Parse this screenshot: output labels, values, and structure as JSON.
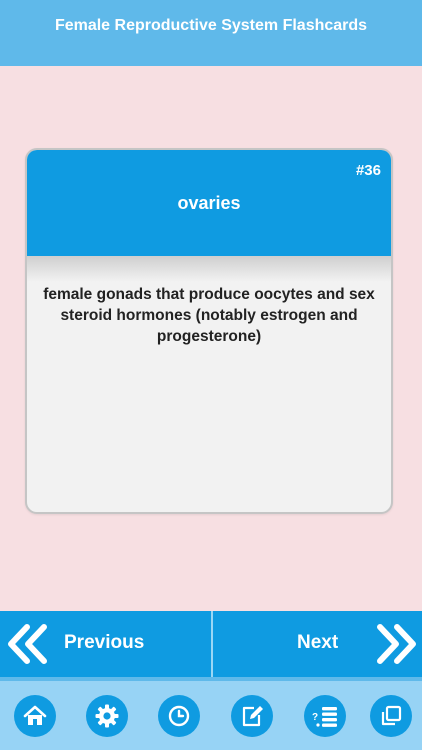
{
  "header": {
    "title": "Female Reproductive System Flashcards"
  },
  "card": {
    "number": "#36",
    "term": "ovaries",
    "definition": "female gonads that produce oocytes and sex steroid hormones (notably estrogen and progesterone)"
  },
  "navigation": {
    "previous_label": "Previous",
    "next_label": "Next"
  },
  "toolbar": {
    "icons": [
      "home-icon",
      "settings-icon",
      "history-icon",
      "edit-icon",
      "quiz-list-icon",
      "copy-icon"
    ]
  },
  "colors": {
    "header": "#5fb9ea",
    "accent": "#0f9be1",
    "background": "#f7dfe2",
    "toolbar": "#97d3f5"
  }
}
